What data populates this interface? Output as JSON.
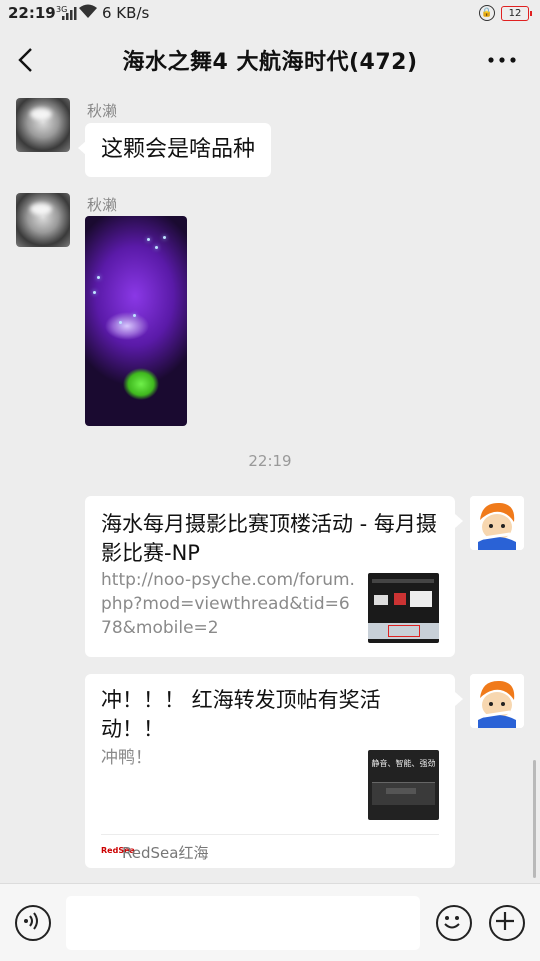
{
  "status_bar": {
    "time": "22:19",
    "signal_label": "3G",
    "net_speed": "6 KB/s",
    "battery": "12"
  },
  "header": {
    "title": "海水之舞4 大航海时代(472)"
  },
  "messages": [
    {
      "sender": "秋濑",
      "text": "这颗会是啥品种"
    },
    {
      "sender": "秋濑",
      "type": "image"
    }
  ],
  "timestamp": "22:19",
  "cards": [
    {
      "title": "海水每月摄影比赛顶楼活动 - 每月摄影比赛-NP",
      "desc": "http://noo-psyche.com/forum.php?mod=viewthread&tid=678&mobile=2"
    },
    {
      "title": "冲！！！ 红海转发顶帖有奖活动！！",
      "desc": "冲鸭！",
      "thumb_caption": "静音、智能、强劲",
      "source": "RedSea红海"
    }
  ],
  "icons": {
    "back": "back-arrow-icon",
    "more": "more-dots-icon",
    "voice": "voice-icon",
    "emoji": "emoji-icon",
    "add": "add-icon"
  }
}
